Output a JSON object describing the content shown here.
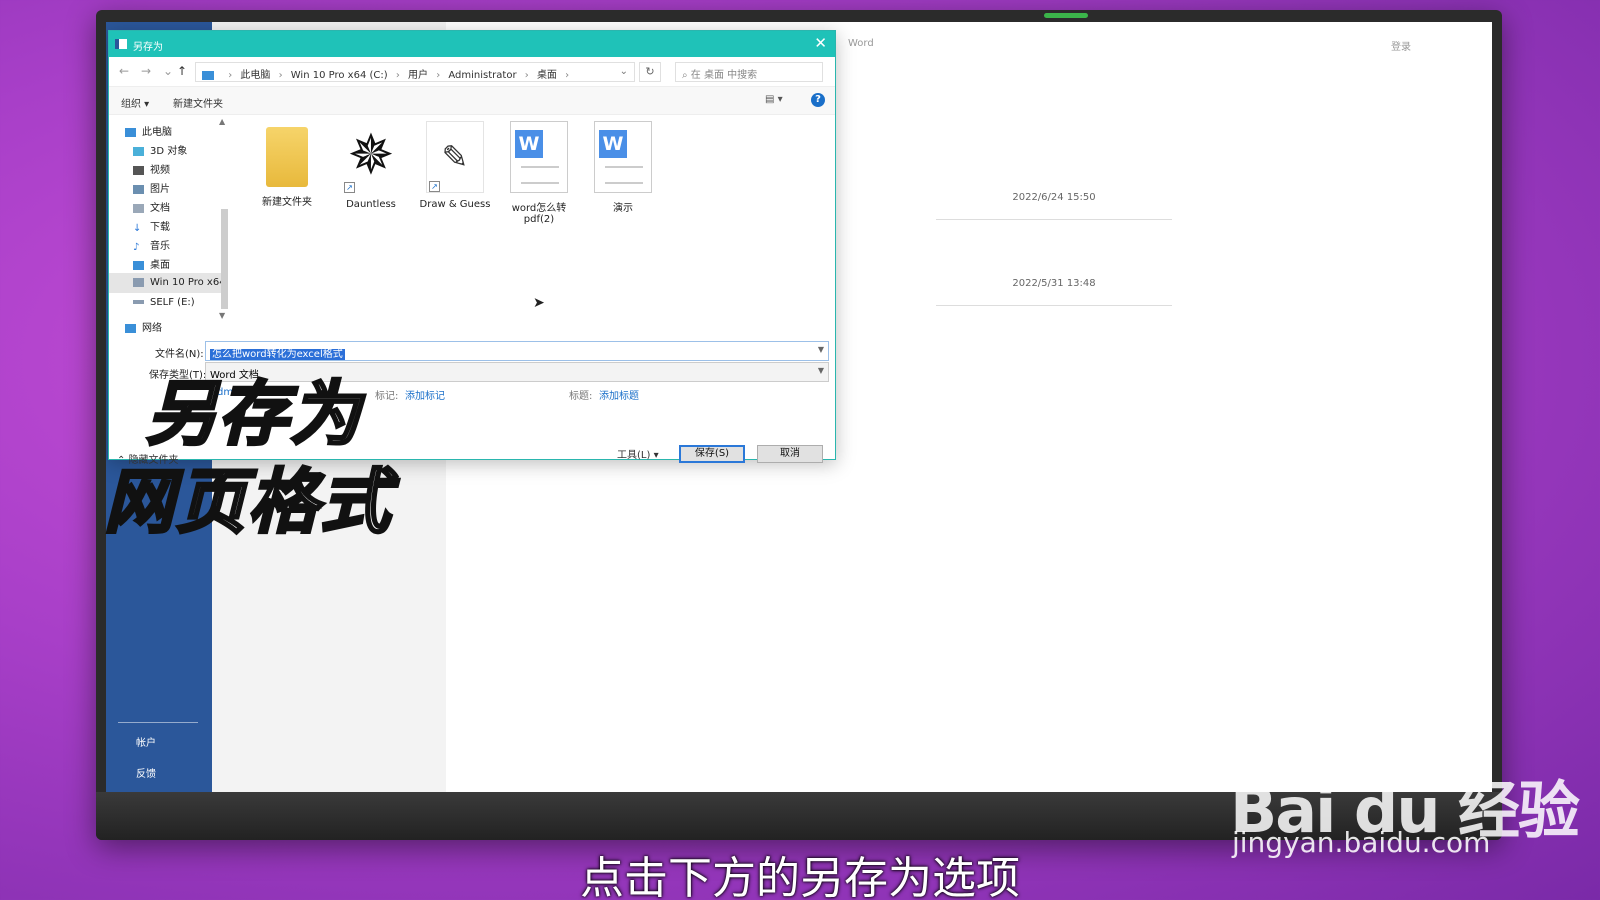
{
  "dialog": {
    "title": "另存为",
    "close_glyph": "✕",
    "breadcrumbs": [
      "此电脑",
      "Win 10 Pro x64 (C:)",
      "用户",
      "Administrator",
      "桌面"
    ],
    "search_placeholder": "在 桌面 中搜索",
    "toolbar": {
      "organize": "组织 ▾",
      "new_folder": "新建文件夹",
      "help": "?"
    },
    "nav_items": [
      {
        "label": "此电脑",
        "color": "#3a8fd8"
      },
      {
        "label": "3D 对象",
        "color": "#4ab0d9"
      },
      {
        "label": "视频",
        "color": "#555555"
      },
      {
        "label": "图片",
        "color": "#6b8fb0"
      },
      {
        "label": "文档",
        "color": "#9aa8b8"
      },
      {
        "label": "下载",
        "color": "#2b78d8"
      },
      {
        "label": "音乐",
        "color": "#2b78d8"
      },
      {
        "label": "桌面",
        "color": "#3a8fd8"
      },
      {
        "label": "Win 10 Pro x64",
        "color": "#8a9bb0"
      },
      {
        "label": "SELF (E:)",
        "color": "#8a9bb0"
      },
      {
        "label": "网络",
        "color": "#3a8fd8"
      }
    ],
    "files": [
      {
        "name": "新建文件夹",
        "type": "folder"
      },
      {
        "name": "Dauntless",
        "type": "shortcut"
      },
      {
        "name": "Draw & Guess",
        "type": "shortcut"
      },
      {
        "name": "word怎么转",
        "name2": "pdf(2)",
        "type": "word"
      },
      {
        "name": "演示",
        "type": "word"
      }
    ],
    "filename_label": "文件名(N):",
    "filename_value": "怎么把word转化为excel格式",
    "savetype_label": "保存类型(T):",
    "savetype_value": "Word 文档",
    "author_value": "dmin",
    "tags_label": "标记:",
    "tags_link": "添加标记",
    "title_label": "标题:",
    "title_link": "添加标题",
    "hide_folders": "隐藏文件夹",
    "tools_label": "工具(L)",
    "save_label": "保存(S)",
    "cancel_label": "取消"
  },
  "word": {
    "title": "Word",
    "login": "登录",
    "dates": [
      "2022/6/24 15:50",
      "2022/5/31 13:48"
    ],
    "account": "帐户",
    "feedback": "反馈"
  },
  "overlay": {
    "line1": "另存为",
    "line2": "网页格式"
  },
  "subtitle": "点击下方的另存为选项",
  "watermark": {
    "logo": "Bai du 经验",
    "url": "jingyan.baidu.com"
  },
  "colors": {
    "titlebar": "#1fc2b8",
    "word_blue": "#2b579a",
    "background": "#b448d0"
  }
}
